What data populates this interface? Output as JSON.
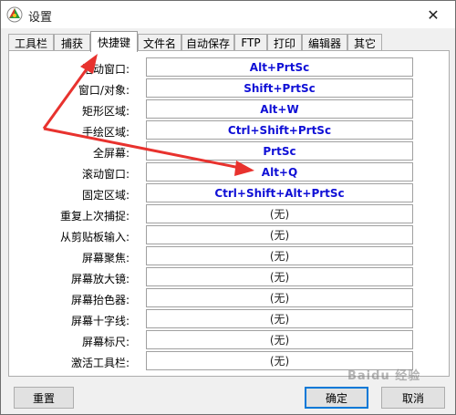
{
  "window": {
    "title": "设置"
  },
  "tabs": [
    {
      "label": "工具栏"
    },
    {
      "label": "捕获"
    },
    {
      "label": "快捷键"
    },
    {
      "label": "文件名"
    },
    {
      "label": "自动保存"
    },
    {
      "label": "FTP"
    },
    {
      "label": "打印"
    },
    {
      "label": "编辑器"
    },
    {
      "label": "其它"
    }
  ],
  "active_tab": "快捷键",
  "hotkeys": [
    {
      "label": "活动窗口:",
      "value": "Alt+PrtSc"
    },
    {
      "label": "窗口/对象:",
      "value": "Shift+PrtSc"
    },
    {
      "label": "矩形区域:",
      "value": "Alt+W"
    },
    {
      "label": "手绘区域:",
      "value": "Ctrl+Shift+PrtSc"
    },
    {
      "label": "全屏幕:",
      "value": "PrtSc"
    },
    {
      "label": "滚动窗口:",
      "value": "Alt+Q"
    },
    {
      "label": "固定区域:",
      "value": "Ctrl+Shift+Alt+PrtSc"
    },
    {
      "label": "重复上次捕捉:",
      "value": "(无)"
    },
    {
      "label": "从剪贴板输入:",
      "value": "(无)"
    },
    {
      "label": "屏幕聚焦:",
      "value": "(无)"
    },
    {
      "label": "屏幕放大镜:",
      "value": "(无)"
    },
    {
      "label": "屏幕抬色器:",
      "value": "(无)"
    },
    {
      "label": "屏幕十字线:",
      "value": "(无)"
    },
    {
      "label": "屏幕标尺:",
      "value": "(无)"
    },
    {
      "label": "激活工具栏:",
      "value": "(无)"
    }
  ],
  "buttons": {
    "reset": "重置",
    "ok": "确定",
    "cancel": "取消"
  },
  "watermark": "Baidu 经验",
  "colors": {
    "hotkey_set": "#1010d6",
    "annotation_arrow": "#e8322e"
  },
  "icons": {
    "app": "app-logo-icon",
    "close": "close-icon"
  }
}
